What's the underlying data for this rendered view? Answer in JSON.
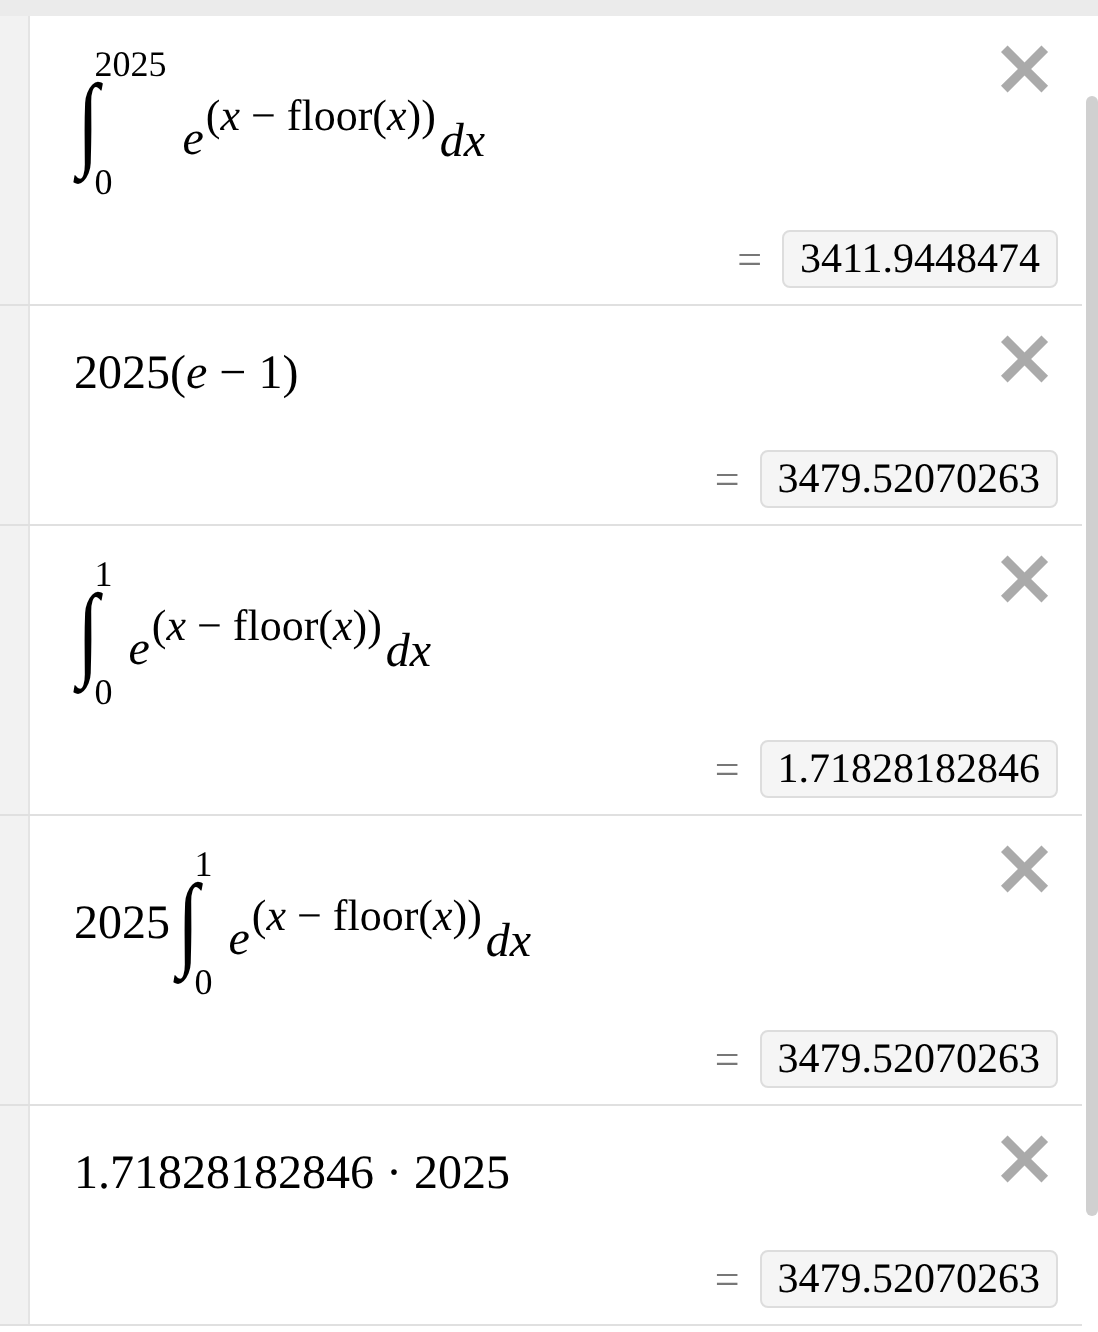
{
  "expressions": [
    {
      "kind": "integral",
      "sign": "∫",
      "upper": "2025",
      "lower": "0",
      "base": "e",
      "exponent": "(*x* − floor(*x*))",
      "differential": "dx",
      "equals": "=",
      "result": "3411.9448474",
      "close": "×"
    },
    {
      "kind": "plain",
      "text": "2025(*e* − 1)",
      "equals": "=",
      "result": "3479.52070263",
      "close": "×"
    },
    {
      "kind": "integral",
      "sign": "∫",
      "upper": "1",
      "lower": "0",
      "base": "e",
      "exponent": "(*x* − floor(*x*))",
      "differential": "dx",
      "equals": "=",
      "result": "1.71828182846",
      "close": "×"
    },
    {
      "kind": "integral",
      "coefficient": "2025",
      "sign": "∫",
      "upper": "1",
      "lower": "0",
      "base": "e",
      "exponent": "(*x* − floor(*x*))",
      "differential": "dx",
      "equals": "=",
      "result": "3479.52070263",
      "close": "×"
    },
    {
      "kind": "plain",
      "text": "1.71828182846 · 2025",
      "equals": "=",
      "result": "3479.52070263",
      "close": "×"
    }
  ]
}
